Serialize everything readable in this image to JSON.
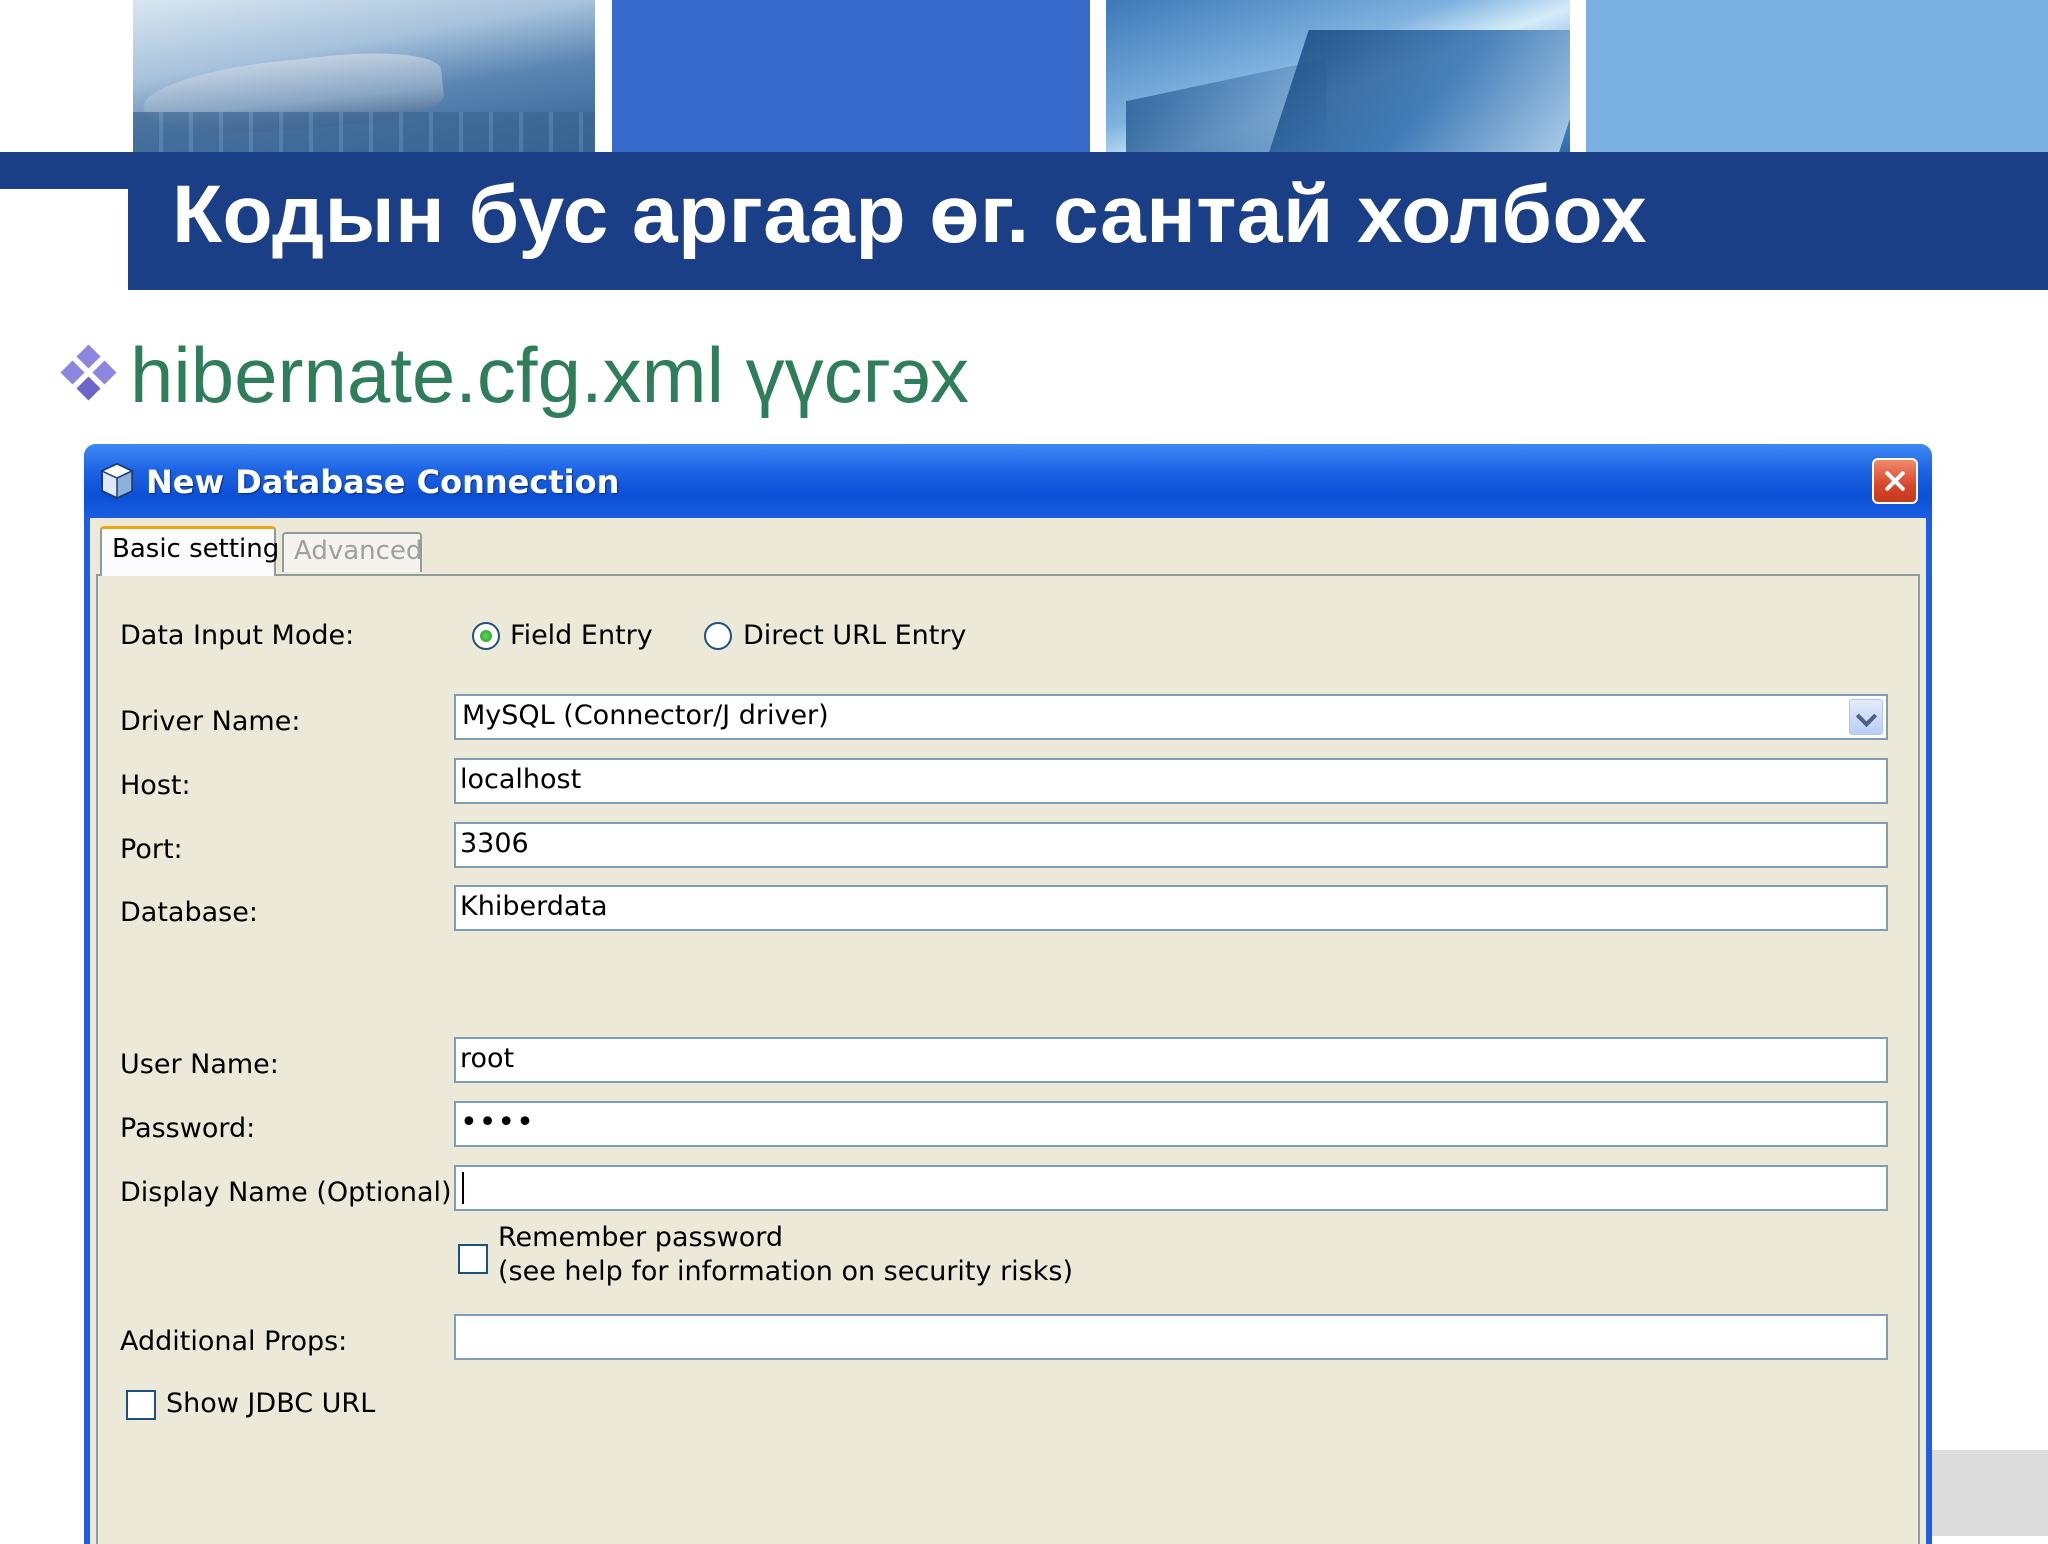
{
  "slide": {
    "title": "Кодын бус аргаар өг. сантай холбох",
    "bullet": "hibernate.cfg.xml үүсгэх"
  },
  "dialog": {
    "title": "New Database Connection",
    "tabs": [
      {
        "label": "Basic setting",
        "active": true
      },
      {
        "label": "Advanced",
        "active": false
      }
    ],
    "input_mode": {
      "label": "Data Input Mode:",
      "options": [
        {
          "label": "Field Entry",
          "selected": true
        },
        {
          "label": "Direct URL Entry",
          "selected": false
        }
      ]
    },
    "driver": {
      "label": "Driver Name:",
      "value": "MySQL (Connector/J driver)"
    },
    "host": {
      "label": "Host:",
      "value": "localhost"
    },
    "port": {
      "label": "Port:",
      "value": "3306"
    },
    "database": {
      "label": "Database:",
      "value": "Khiberdata"
    },
    "username": {
      "label": "User Name:",
      "value": "root"
    },
    "password": {
      "label": "Password:",
      "value": "••••"
    },
    "display_name": {
      "label": "Display Name (Optional):",
      "value": ""
    },
    "remember": {
      "label": "Remember password",
      "note": "(see help for information on security risks)",
      "checked": false
    },
    "additional_props": {
      "label": "Additional Props:",
      "value": ""
    },
    "show_jdbc": {
      "label": "Show JDBC URL",
      "checked": false
    }
  },
  "colors": {
    "title_band": "#1a3f86",
    "bullet_text": "#2e7d5b",
    "xp_blue": "#1f5ee0",
    "dialog_bg": "#ece9d8"
  }
}
